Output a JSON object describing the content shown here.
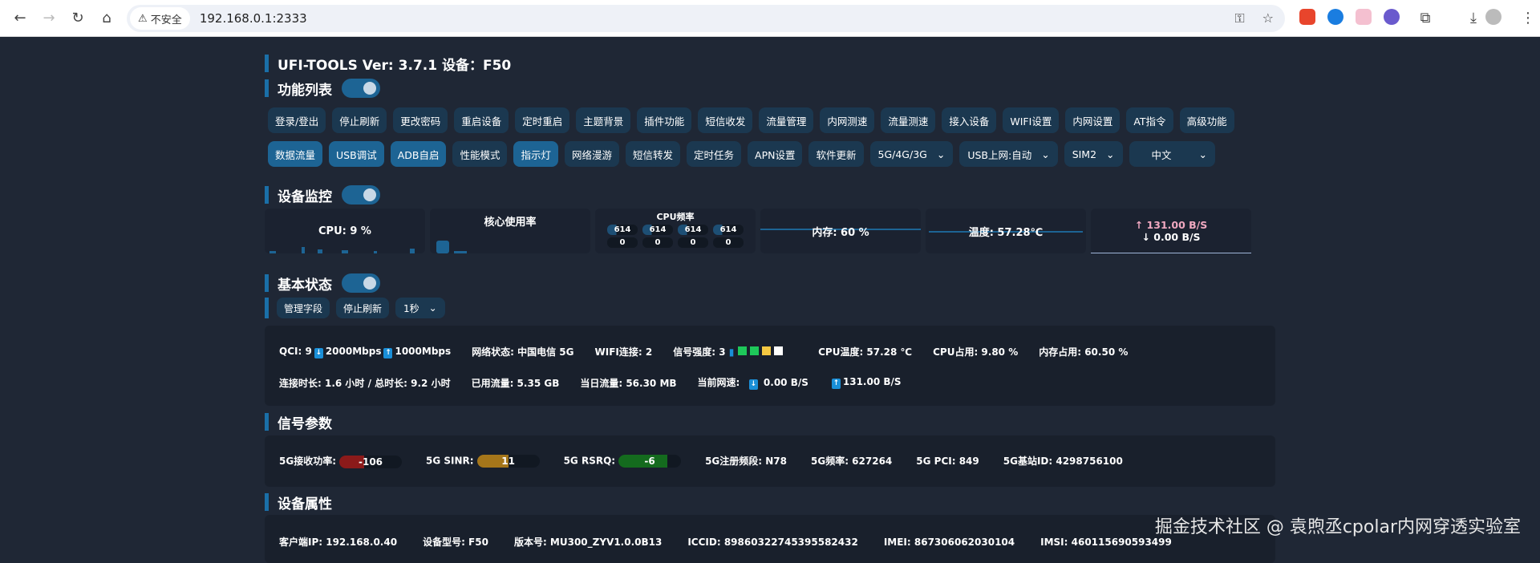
{
  "browser": {
    "security": "不安全",
    "url": "192.168.0.1:2333"
  },
  "title": "UFI-TOOLS Ver: 3.7.1 设备：F50",
  "sections": {
    "functions": "功能列表",
    "monitor": "设备监控",
    "basic": "基本状态",
    "signal": "信号参数",
    "device": "设备属性"
  },
  "buttons_row1": [
    "登录/登出",
    "停止刷新",
    "更改密码",
    "重启设备",
    "定时重启",
    "主题背景",
    "插件功能",
    "短信收发",
    "流量管理",
    "内网测速",
    "流量测速",
    "接入设备",
    "WIFI设置",
    "内网设置",
    "AT指令",
    "高级功能"
  ],
  "buttons_row2": [
    {
      "label": "数据流量",
      "active": true
    },
    {
      "label": "USB调试",
      "active": true
    },
    {
      "label": "ADB自启",
      "active": true
    },
    {
      "label": "性能模式",
      "active": false
    },
    {
      "label": "指示灯",
      "active": true
    },
    {
      "label": "网络漫游",
      "active": false
    },
    {
      "label": "短信转发",
      "active": false
    },
    {
      "label": "定时任务",
      "active": false
    },
    {
      "label": "APN设置",
      "active": false
    },
    {
      "label": "软件更新",
      "active": false
    }
  ],
  "selects": [
    "5G/4G/3G",
    "USB上网:自动",
    "SIM2",
    "中文"
  ],
  "monitor": {
    "cpu": "CPU: 9 %",
    "core_title": "核心使用率",
    "freq_title": "CPU频率",
    "freqs": [
      "614",
      "614",
      "614",
      "614"
    ],
    "usage": [
      "0",
      "0",
      "0",
      "0"
    ],
    "mem": "内存: 60 %",
    "temp": "温度: 57.28℃",
    "up": "↑ 131.00 B/S",
    "down": "↓  0.00 B/S"
  },
  "basic_controls": {
    "manage": "管理字段",
    "stop": "停止刷新",
    "interval": "1秒"
  },
  "basic": {
    "row1": {
      "qci": "QCI:  9",
      "down_max": "2000Mbps",
      "up_max": "1000Mbps",
      "net": "网络状态:  中国电信 5G",
      "wifi": "WIFI连接:  2",
      "signal": "信号强度:  3",
      "cpu_temp": "CPU温度:   57.28 ℃",
      "cpu_use": "CPU占用:    9.80 %",
      "mem_use": "内存占用:   60.50 %"
    },
    "row2": {
      "conn": "连接时长:  1.6 小时 / 总时长: 9.2 小时",
      "used": "已用流量:  5.35 GB",
      "today": "当日流量:  56.30 MB",
      "speed": "当前网速:",
      "down": "0.00 B/S",
      "up": "131.00 B/S"
    }
  },
  "signal": {
    "rsrp_label": "5G接收功率:",
    "rsrp": "-106",
    "sinr_label": "5G SINR:",
    "sinr": "11",
    "rsrq_label": "5G RSRQ:",
    "rsrq": "-6",
    "band": "5G注册频段:  N78",
    "freq": "5G频率:  627264",
    "pci": "5G PCI:  849",
    "cell": "5G基站ID:  4298756100"
  },
  "device": {
    "ip": "客户端IP:  192.168.0.40",
    "model": "设备型号:  F50",
    "version": "版本号:  MU300_ZYV1.0.0B13",
    "iccid": "ICCID:  89860322745395582432",
    "imei": "IMEI:  867306062030104",
    "imsi": "IMSI:  460115690593499"
  },
  "watermark": "掘金技术社区 @ 袁煦丞cpolar内网穿透实验室",
  "colors": {
    "bg": "#1f2735",
    "accent": "#1d6494",
    "rsrp": "#8b1a1a",
    "sinr": "#a5761a",
    "rsrq": "#146b1e",
    "up_text": "#f0a8c0"
  }
}
